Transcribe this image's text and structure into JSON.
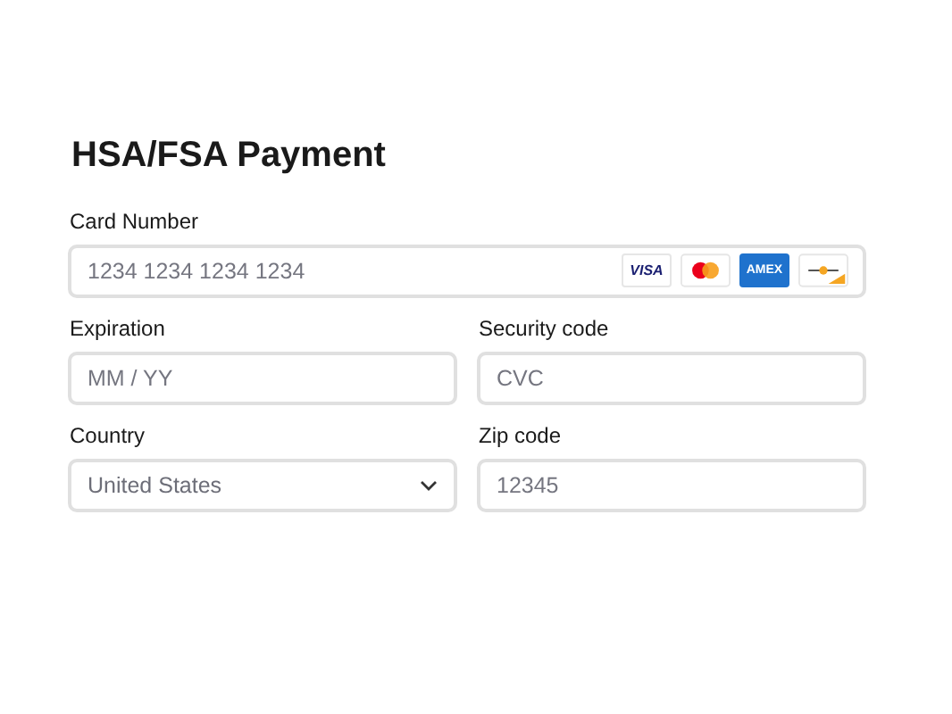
{
  "title": "HSA/FSA Payment",
  "card_number": {
    "label": "Card Number",
    "placeholder": "1234 1234 1234 1234",
    "brands": [
      {
        "kind": "visa",
        "text": "VISA"
      },
      {
        "kind": "mastercard"
      },
      {
        "kind": "amex",
        "text": "AMEX"
      },
      {
        "kind": "other"
      }
    ]
  },
  "expiration": {
    "label": "Expiration",
    "placeholder": "MM / YY"
  },
  "security_code": {
    "label": "Security code",
    "placeholder": "CVC"
  },
  "country": {
    "label": "Country",
    "value": "United States"
  },
  "zip_code": {
    "label": "Zip code",
    "placeholder": "12345"
  }
}
